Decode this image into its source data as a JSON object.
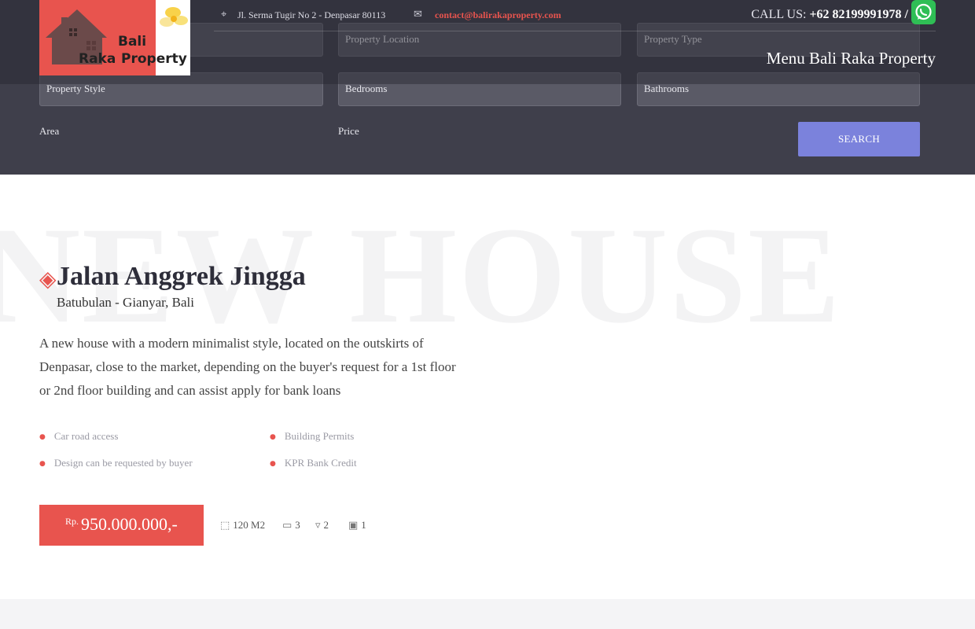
{
  "search": {
    "fields": {
      "property_location": "Property Location",
      "property_type": "Property Type",
      "property_style": "Property Style",
      "bedrooms": "Bedrooms",
      "bathrooms": "Bathrooms"
    },
    "area_label": "Area",
    "price_label": "Price",
    "search_button": "SEARCH"
  },
  "header": {
    "logo": {
      "line1": "Bali",
      "line2": "Raka",
      "line3": "Property"
    },
    "address": "Jl. Serma Tugir No 2 - Denpasar 80113",
    "email": "contact@balirakaproperty.com",
    "call_label": "CALL US:",
    "phone": "+62 82199991978 /",
    "menu_label": "Menu Bali Raka Property",
    "colors": {
      "accent": "#e8544e",
      "email_link": "#e8544e",
      "whatsapp": "#2fbe55",
      "search_button": "#7b82dc"
    }
  },
  "listing": {
    "watermark": "NEW HOUSE",
    "title": "Jalan Anggrek Jingga",
    "location": "Batubulan - Gianyar, Bali",
    "description": "A new house with a modern minimalist style, located on the outskirts of Denpasar, close to the market, depending on the buyer's request for a 1st floor or 2nd floor building and can assist apply for bank loans",
    "features": [
      "Car road access",
      "Building Permits",
      "Design can be requested by buyer",
      "KPR Bank Credit"
    ],
    "price_currency": "Rp.",
    "price_amount": "950.000.000,-",
    "specs": {
      "area": "120 M2",
      "bedrooms": "3",
      "bathrooms": "2",
      "garage": "1"
    }
  }
}
